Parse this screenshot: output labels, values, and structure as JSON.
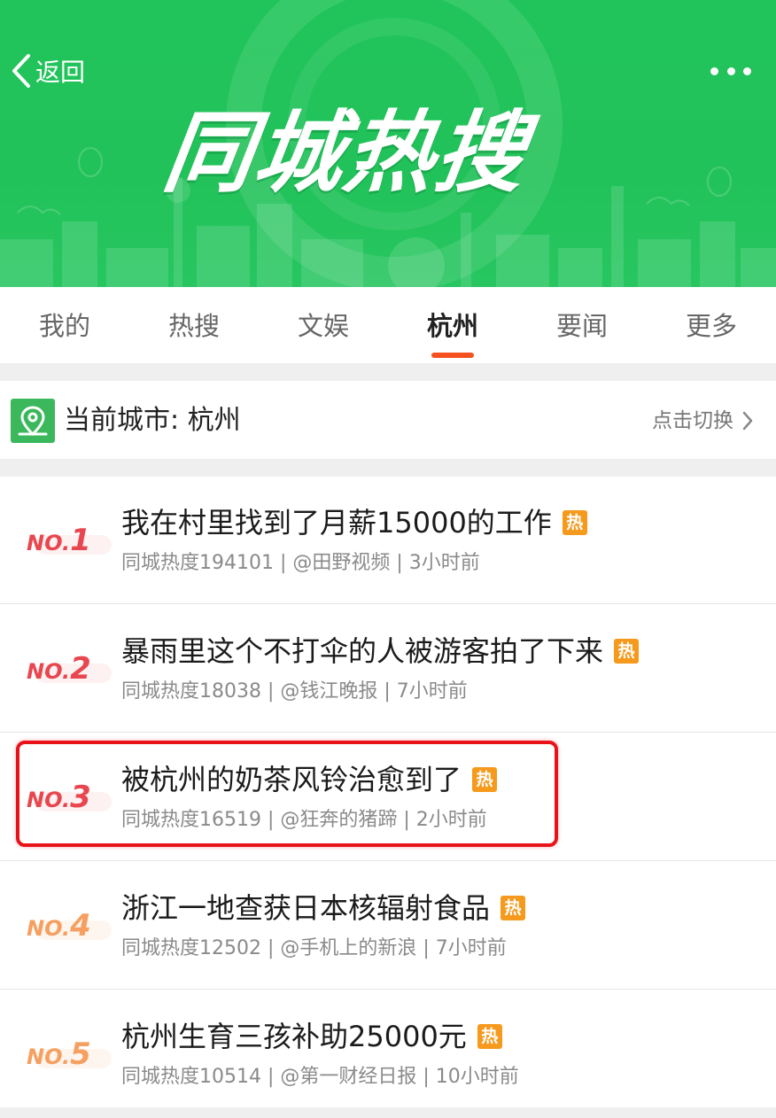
{
  "header": {
    "back_label": "返回",
    "banner_title": "同城热搜"
  },
  "tabs": [
    {
      "label": "我的"
    },
    {
      "label": "热搜"
    },
    {
      "label": "文娱"
    },
    {
      "label": "杭州",
      "active": true
    },
    {
      "label": "要闻"
    },
    {
      "label": "更多"
    }
  ],
  "city": {
    "label": "当前城市: 杭州",
    "switch_label": "点击切换"
  },
  "hot_badge": "热",
  "items": [
    {
      "rank_prefix": "NO.",
      "rank": "1",
      "title": "我在村里找到了月薪15000的工作",
      "meta": "同城热度194101 | @田野视频 | 3小时前"
    },
    {
      "rank_prefix": "NO.",
      "rank": "2",
      "title": "暴雨里这个不打伞的人被游客拍了下来",
      "meta": "同城热度18038 | @钱江晚报 | 7小时前"
    },
    {
      "rank_prefix": "NO.",
      "rank": "3",
      "title": "被杭州的奶茶风铃治愈到了",
      "meta": "同城热度16519 | @狂奔的猪蹄 | 2小时前"
    },
    {
      "rank_prefix": "NO.",
      "rank": "4",
      "title": "浙江一地查获日本核辐射食品",
      "meta": "同城热度12502 | @手机上的新浪 | 7小时前"
    },
    {
      "rank_prefix": "NO.",
      "rank": "5",
      "title": "杭州生育三孩补助25000元",
      "meta": "同城热度10514 | @第一财经日报 | 10小时前"
    }
  ],
  "colors": {
    "banner_green": "#22c25a",
    "tab_underline": "#f4511e",
    "rank_top": "#e8474f",
    "rank_other": "#f5a060",
    "hot_badge": "#f59a1d",
    "highlight_border": "#e8131a"
  }
}
